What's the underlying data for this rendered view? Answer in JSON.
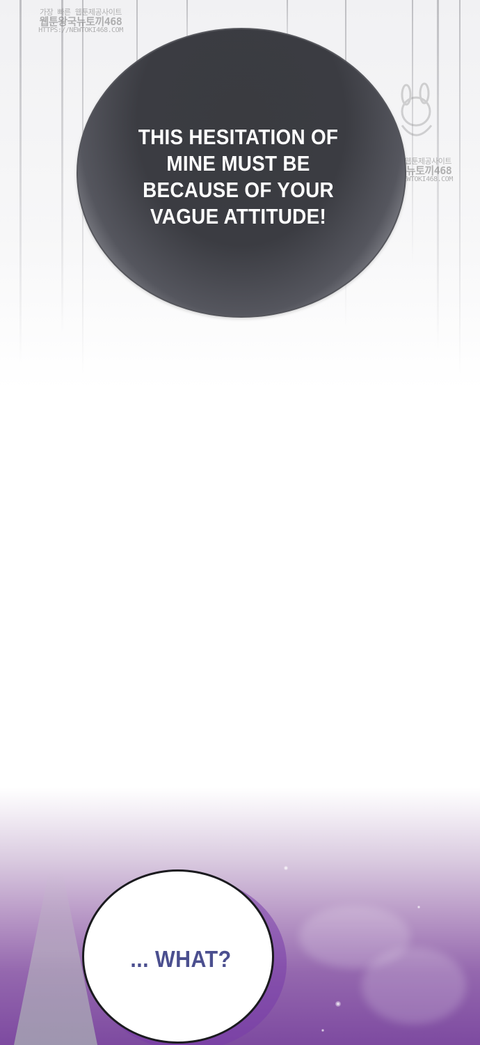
{
  "panels": {
    "top": {
      "speech_bubble": {
        "lines": [
          "THIS HESITATION OF",
          "MINE MUST BE",
          "BECAUSE OF YOUR",
          "VAGUE ATTITUDE!"
        ]
      }
    },
    "bottom": {
      "speech_bubble": {
        "text": "... WHAT?",
        "color": "#4b4f8f"
      }
    }
  },
  "watermarks": [
    {
      "line1": "가장 빠른 웹툰제공사이트",
      "line2": "웹툰왕국뉴토끼468",
      "line3": "HTTPS://NEWTOKI468.COM"
    },
    {
      "line1": "가장 빠른 웹툰제공사이트",
      "line2": "웹툰왕국뉴토끼468",
      "line3": "HTTPS://NEWTOKI468.COM"
    }
  ],
  "colors": {
    "dark_bubble_fill": "#3a3b40",
    "sky_purple": "#7d4aa0"
  }
}
